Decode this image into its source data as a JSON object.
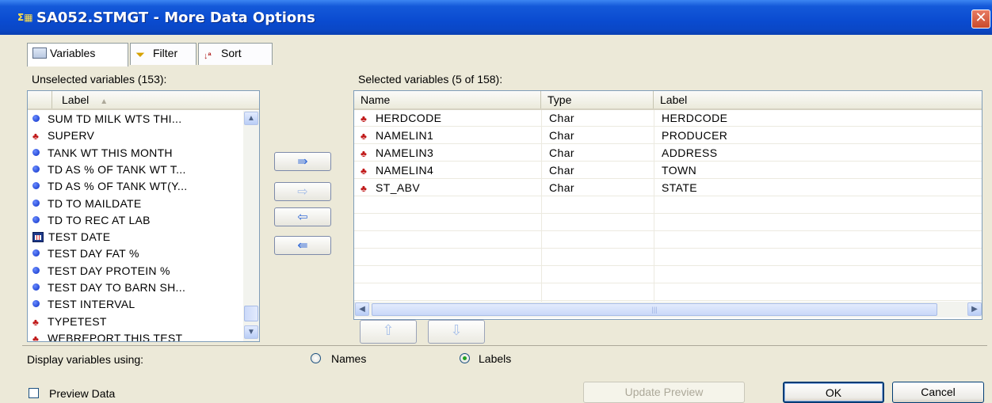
{
  "window": {
    "icon": "sigma-table-icon",
    "title": "SA052.STMGT - More Data Options",
    "close_glyph": "✕"
  },
  "tabs": [
    {
      "label": "Variables",
      "icon": "variables-icon",
      "selected": true
    },
    {
      "label": "Filter",
      "icon": "filter-funnel-icon",
      "selected": false
    },
    {
      "label": "Sort",
      "icon": "sort-az-icon",
      "selected": false
    }
  ],
  "unselected": {
    "caption": "Unselected variables (153):",
    "header": "Label",
    "items": [
      {
        "label": "SUM TD MILK WTS THI...",
        "icon": "numeric-icon"
      },
      {
        "label": "SUPERV",
        "icon": "character-icon"
      },
      {
        "label": "TANK WT THIS MONTH",
        "icon": "numeric-icon"
      },
      {
        "label": "TD AS % OF TANK WT T...",
        "icon": "numeric-icon"
      },
      {
        "label": "TD AS % OF TANK WT(Y...",
        "icon": "numeric-icon"
      },
      {
        "label": "TD TO MAILDATE",
        "icon": "numeric-icon"
      },
      {
        "label": "TD TO REC AT LAB",
        "icon": "numeric-icon"
      },
      {
        "label": "TEST DATE",
        "icon": "date-icon"
      },
      {
        "label": "TEST DAY FAT %",
        "icon": "numeric-icon"
      },
      {
        "label": "TEST DAY PROTEIN %",
        "icon": "numeric-icon"
      },
      {
        "label": "TEST DAY TO BARN SH...",
        "icon": "numeric-icon"
      },
      {
        "label": "TEST INTERVAL",
        "icon": "numeric-icon"
      },
      {
        "label": "TYPETEST",
        "icon": "character-icon"
      },
      {
        "label": "WEBREPORT THIS TEST",
        "icon": "character-icon"
      }
    ]
  },
  "move_buttons": [
    {
      "glyph": "⇛",
      "name": "add-all-button",
      "enabled": true
    },
    {
      "glyph": "⇨",
      "name": "add-button",
      "enabled": false
    },
    {
      "glyph": "⇦",
      "name": "remove-button",
      "enabled": true
    },
    {
      "glyph": "⇚",
      "name": "remove-all-button",
      "enabled": true
    }
  ],
  "selected": {
    "caption": "Selected variables (5 of 158):",
    "columns": [
      "Name",
      "Type",
      "Label"
    ],
    "rows": [
      {
        "name": "HERDCODE",
        "type": "Char",
        "label": "HERDCODE"
      },
      {
        "name": "NAMELIN1",
        "type": "Char",
        "label": "PRODUCER"
      },
      {
        "name": "NAMELIN3",
        "type": "Char",
        "label": "ADDRESS"
      },
      {
        "name": "NAMELIN4",
        "type": "Char",
        "label": "TOWN"
      },
      {
        "name": "ST_ABV",
        "type": "Char",
        "label": "STATE"
      }
    ]
  },
  "order_buttons": {
    "up": "⇧",
    "down": "⇩"
  },
  "display": {
    "caption": "Display variables using:",
    "options": [
      {
        "label": "Names",
        "checked": false
      },
      {
        "label": "Labels",
        "checked": true
      }
    ]
  },
  "preview": {
    "label": "Preview Data",
    "checked": false
  },
  "buttons": {
    "update_preview": "Update Preview",
    "ok": "OK",
    "cancel": "Cancel"
  },
  "colors": {
    "titlebar": "#0a4bd0",
    "dialog_bg": "#ece9d8",
    "numeric_icon": "#0a2ec6",
    "character_icon": "#c01818"
  }
}
